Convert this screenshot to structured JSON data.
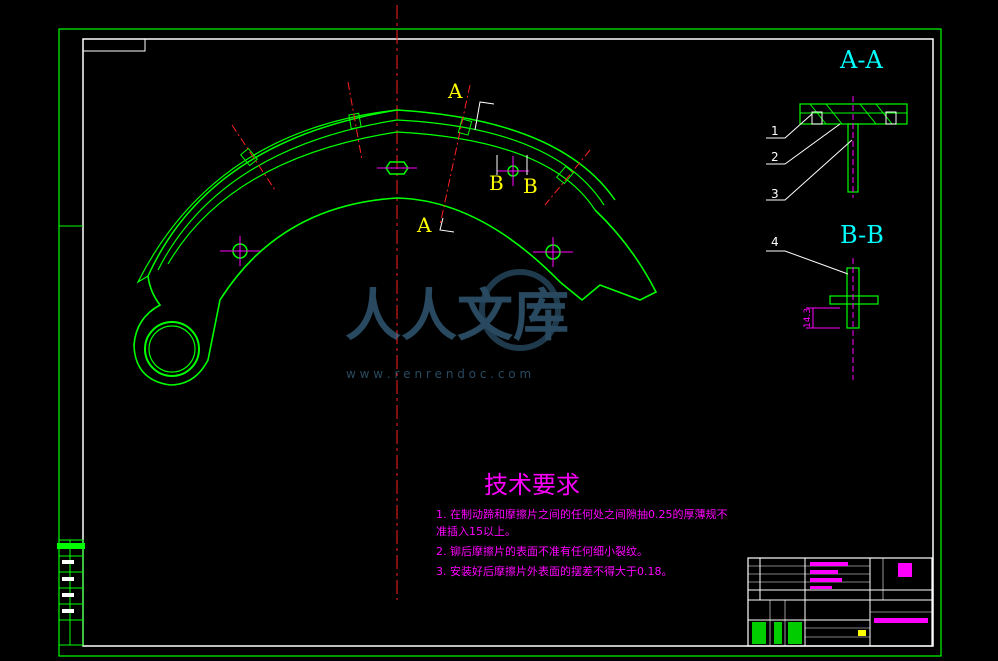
{
  "section_views": {
    "aa_title": "A-A",
    "bb_title": "B-B",
    "leaders": [
      "1",
      "2",
      "3",
      "4"
    ],
    "dimension": "14.3"
  },
  "main_view": {
    "cut_a_top": "A",
    "cut_a_bottom": "A",
    "cut_b_left": "B",
    "cut_b_right": "B"
  },
  "requirements": {
    "title": "技术要求",
    "line1": "1. 在制动蹄和摩擦片之间的任何处之间隙抽0.25的厚薄规不",
    "line1b": "准插入15以上。",
    "line2": "2. 铆后摩擦片的表面不准有任何细小裂纹。",
    "line3": "3. 安装好后摩擦片外表面的摆差不得大于0.18。"
  },
  "watermark": {
    "brand": "人人文库",
    "url": "w w w . r e n r e n d o c . c o m"
  },
  "colors": {
    "frame": "#00ff00",
    "text_magenta": "#ff00ff",
    "labels_yellow": "#ffff00",
    "center_red": "#ff2020"
  }
}
